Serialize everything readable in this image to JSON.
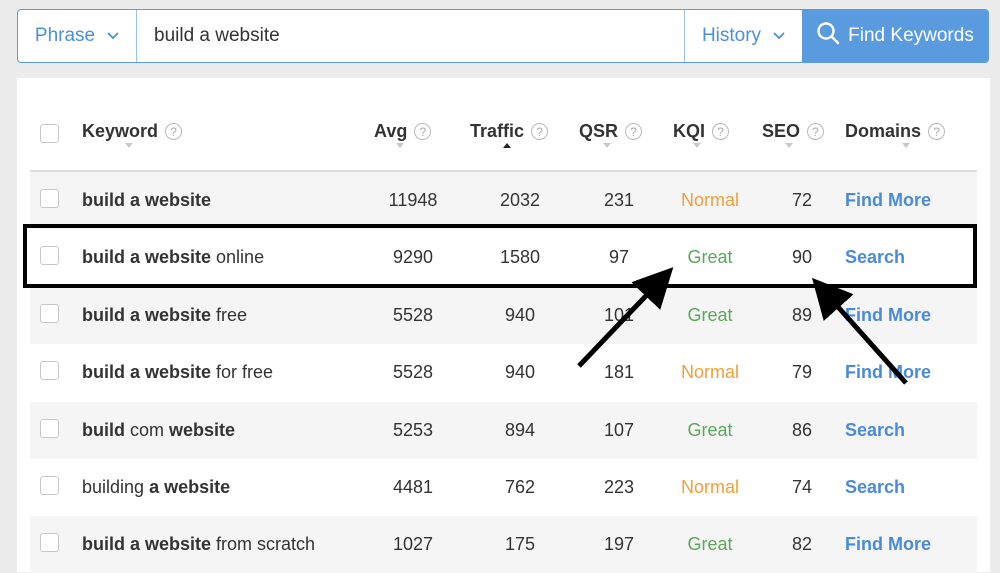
{
  "search": {
    "type_label": "Phrase",
    "query": "build a website",
    "history_label": "History",
    "find_label": "Find Keywords"
  },
  "table": {
    "headers": [
      "Keyword",
      "Avg",
      "Traffic",
      "QSR",
      "KQI",
      "SEO",
      "Domains"
    ],
    "rows": [
      {
        "kw": [
          [
            "build a website",
            true
          ]
        ],
        "avg": "11948",
        "traffic": "2032",
        "qsr": "231",
        "kqi": "Normal",
        "seo": "72",
        "domains": "Find More"
      },
      {
        "kw": [
          [
            "build a website",
            true
          ],
          [
            " online",
            false
          ]
        ],
        "avg": "9290",
        "traffic": "1580",
        "qsr": "97",
        "kqi": "Great",
        "seo": "90",
        "domains": "Search"
      },
      {
        "kw": [
          [
            "build a website",
            true
          ],
          [
            " free",
            false
          ]
        ],
        "avg": "5528",
        "traffic": "940",
        "qsr": "101",
        "kqi": "Great",
        "seo": "89",
        "domains": "Find More"
      },
      {
        "kw": [
          [
            "build a website",
            true
          ],
          [
            " for free",
            false
          ]
        ],
        "avg": "5528",
        "traffic": "940",
        "qsr": "181",
        "kqi": "Normal",
        "seo": "79",
        "domains": "Find More"
      },
      {
        "kw": [
          [
            "build",
            true
          ],
          [
            " com ",
            false
          ],
          [
            "website",
            true
          ]
        ],
        "avg": "5253",
        "traffic": "894",
        "qsr": "107",
        "kqi": "Great",
        "seo": "86",
        "domains": "Search"
      },
      {
        "kw": [
          [
            "building ",
            false
          ],
          [
            "a website",
            true
          ]
        ],
        "avg": "4481",
        "traffic": "762",
        "qsr": "223",
        "kqi": "Normal",
        "seo": "74",
        "domains": "Search"
      },
      {
        "kw": [
          [
            "build a website",
            true
          ],
          [
            " from scratch",
            false
          ]
        ],
        "avg": "1027",
        "traffic": "175",
        "qsr": "197",
        "kqi": "Great",
        "seo": "82",
        "domains": "Find More"
      }
    ]
  },
  "colors": {
    "accent": "#5a9be0",
    "link": "#4a8ad6",
    "kqi_great": "#5aa85a",
    "kqi_normal": "#f0a038"
  }
}
